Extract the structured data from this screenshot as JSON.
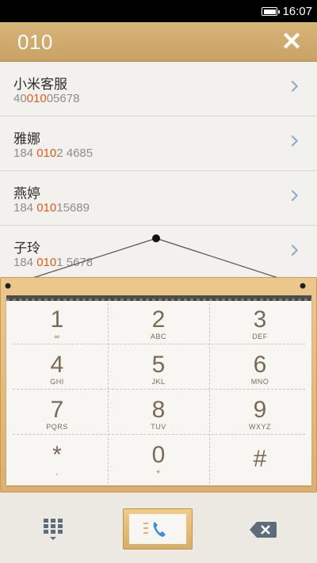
{
  "status_bar": {
    "time": "16:07"
  },
  "search": {
    "query": "010",
    "clear_icon": "close-icon"
  },
  "results": [
    {
      "name": "小米客服",
      "number_pre": "40",
      "number_hl": "010",
      "number_post": "05678"
    },
    {
      "name": "雅娜",
      "number_pre": "184 ",
      "number_hl": "010",
      "number_post": "2 4685"
    },
    {
      "name": "燕婷",
      "number_pre": "184 ",
      "number_hl": "010",
      "number_post": "15689"
    },
    {
      "name": "子玲",
      "number_pre": "184 ",
      "number_hl": "010",
      "number_post": "1 5678"
    }
  ],
  "keypad": [
    {
      "digit": "1",
      "letters": "∞"
    },
    {
      "digit": "2",
      "letters": "ABC"
    },
    {
      "digit": "3",
      "letters": "DEF"
    },
    {
      "digit": "4",
      "letters": "GHI"
    },
    {
      "digit": "5",
      "letters": "JKL"
    },
    {
      "digit": "6",
      "letters": "MNO"
    },
    {
      "digit": "7",
      "letters": "PQRS"
    },
    {
      "digit": "8",
      "letters": "TUV"
    },
    {
      "digit": "9",
      "letters": "WXYZ"
    },
    {
      "digit": "*",
      "letters": ","
    },
    {
      "digit": "0",
      "letters": "+"
    },
    {
      "digit": "#",
      "letters": ""
    }
  ],
  "bottom_bar": {
    "dialpad_icon": "dialpad-icon",
    "call_icon": "phone-icon",
    "backspace_icon": "backspace-icon"
  },
  "colors": {
    "header": "#d0aa6c",
    "highlight": "#e05a19",
    "keypad_digit": "#7a6a55",
    "chevron": "#8da9c5",
    "call_icon": "#3f8fd6"
  }
}
